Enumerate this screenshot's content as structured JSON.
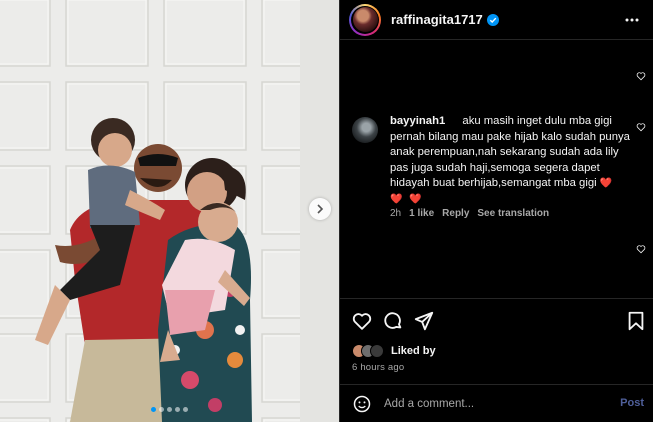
{
  "post": {
    "username": "raffinagita1717",
    "carousel": {
      "slide_count": 5,
      "active_slide": 1
    }
  },
  "comment": {
    "username": "bayyinah1",
    "text": "aku masih inget dulu mba gigi pernah bilang mau pake hijab kalo sudah punya anak perempuan,nah sekarang sudah ada lily pas juga sudah haji,semoga segera dapet hidayah buat berhijab,semangat mba gigi",
    "hearts": "❤️ ❤️ ❤️",
    "age": "2h",
    "likes": "1 like",
    "reply_label": "Reply",
    "translate_label": "See translation"
  },
  "likes": {
    "label": "Liked by"
  },
  "timestamp": "6 hours ago",
  "composer": {
    "placeholder": "Add a comment...",
    "post_label": "Post"
  },
  "icons": [
    "verified-badge-icon",
    "more-options-icon",
    "heart-icon",
    "comment-icon",
    "share-icon",
    "save-icon",
    "emoji-icon",
    "chevron-right-icon"
  ],
  "colors": {
    "background": "#000000",
    "verified": "#0095f6",
    "heart": "#ed4956",
    "post_button": "#4f5f9a",
    "muted_text": "#a8a8a8"
  }
}
